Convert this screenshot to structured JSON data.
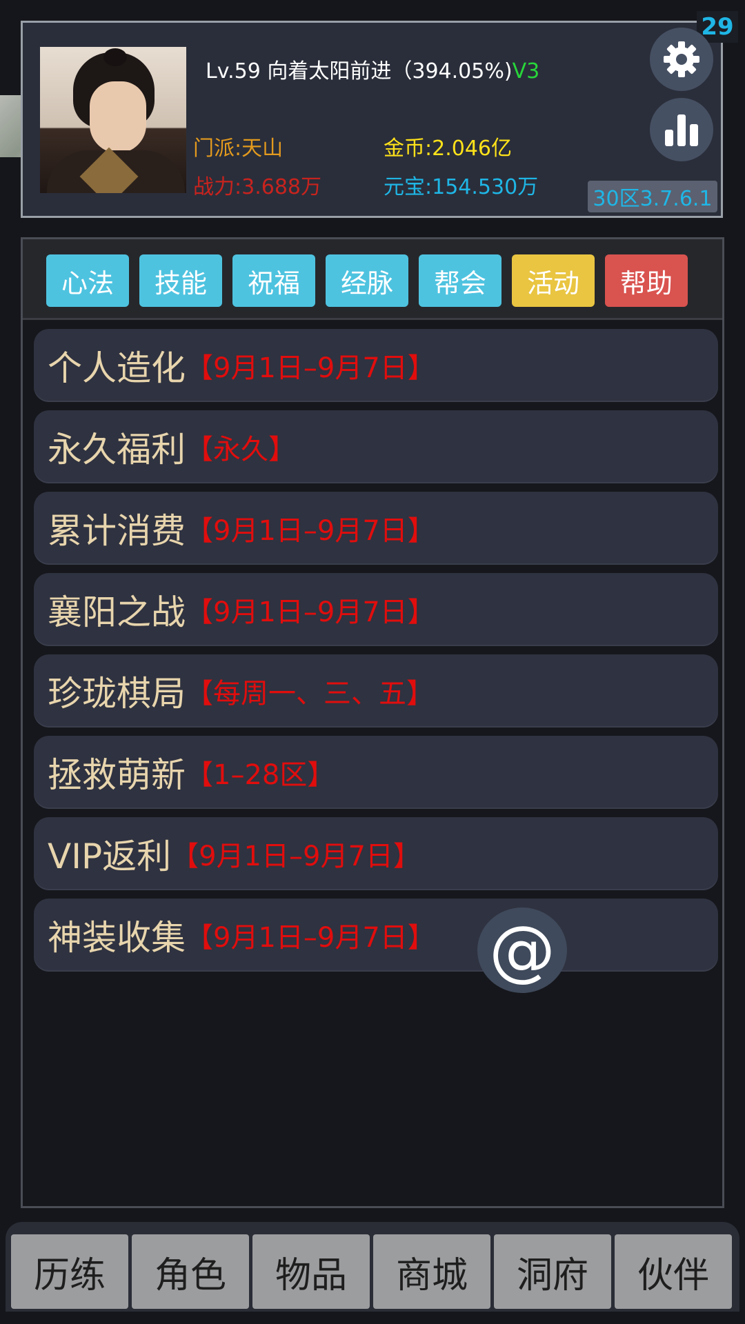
{
  "notification_count": "29",
  "player": {
    "level_line": "Lv.59 向着太阳前进（394.05%)",
    "vip": "V3",
    "sect": "门派:天山",
    "power": "战力:3.688万",
    "gold": "金币:2.046亿",
    "ingot": "元宝:154.530万",
    "server": "30区3.7.6.1"
  },
  "icons": {
    "settings": "gear-icon",
    "stats": "bar-chart-icon",
    "float": "at-icon"
  },
  "tabs": [
    {
      "label": "心法",
      "color": "#4ec3e0"
    },
    {
      "label": "技能",
      "color": "#4ec3e0"
    },
    {
      "label": "祝福",
      "color": "#4ec3e0"
    },
    {
      "label": "经脉",
      "color": "#4ec3e0"
    },
    {
      "label": "帮会",
      "color": "#4ec3e0"
    },
    {
      "label": "活动",
      "color": "#e9c541"
    },
    {
      "label": "帮助",
      "color": "#d9534f"
    }
  ],
  "activities": [
    {
      "name": "个人造化",
      "date": "【9月1日–9月7日】"
    },
    {
      "name": "永久福利",
      "date": "【永久】"
    },
    {
      "name": "累计消费",
      "date": "【9月1日–9月7日】"
    },
    {
      "name": "襄阳之战",
      "date": "【9月1日–9月7日】"
    },
    {
      "name": "珍珑棋局",
      "date": "【每周一、三、五】"
    },
    {
      "name": "拯救萌新",
      "date": "【1–28区】"
    },
    {
      "name": "VIP返利",
      "date": "【9月1日–9月7日】"
    },
    {
      "name": "神装收集",
      "date": "【9月1日–9月7日】"
    }
  ],
  "float_button": "@",
  "bottom_nav": [
    "历练",
    "角色",
    "物品",
    "商城",
    "洞府",
    "伙伴"
  ]
}
